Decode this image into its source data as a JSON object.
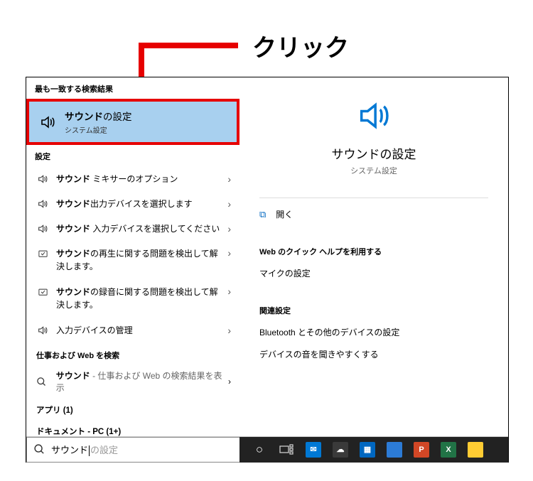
{
  "annotation": {
    "label": "クリック"
  },
  "left": {
    "best_match_header": "最も一致する検索結果",
    "best_match": {
      "title_bold": "サウンド",
      "title_rest": "の設定",
      "subtitle": "システム設定"
    },
    "settings_header": "設定",
    "rows": [
      {
        "icon": "speaker",
        "bold": "サウンド",
        "rest": " ミキサーのオプション",
        "chevron": true
      },
      {
        "icon": "speaker",
        "bold": "サウンド",
        "rest": "出力デバイスを選択します",
        "chevron": true
      },
      {
        "icon": "speaker",
        "bold": "サウンド",
        "rest": " 入力デバイスを選択してください",
        "chevron": true
      },
      {
        "icon": "trouble",
        "bold": "サウンド",
        "rest": "の再生に関する問題を検出して解決します。",
        "chevron": true,
        "twoline": true
      },
      {
        "icon": "trouble",
        "bold": "サウンド",
        "rest": "の録音に関する問題を検出して解決します。",
        "chevron": true,
        "twoline": true
      },
      {
        "icon": "speaker",
        "bold": "",
        "rest": "入力デバイスの管理",
        "chevron": true
      }
    ],
    "websearch_header": "仕事および Web を検索",
    "websearch": {
      "bold": "サウンド",
      "tail": " - 仕事および Web の検索結果を表示",
      "chevron": true
    },
    "apps_row": "アプリ (1)",
    "docs_row": "ドキュメント - PC (1+)"
  },
  "right": {
    "title": "サウンドの設定",
    "subtitle": "システム設定",
    "open_label": "開く",
    "quickhelp_header": "Web のクイック ヘルプを利用する",
    "quickhelp_link": "マイクの設定",
    "related_header": "関連設定",
    "related_links": [
      "Bluetooth とその他のデバイスの設定",
      "デバイスの音を聞きやすくする"
    ]
  },
  "search": {
    "typed": "サウンド",
    "placeholder_rest": "の設定"
  },
  "taskbar_apps": [
    {
      "name": "mail",
      "color": "#0078d4",
      "letter": "✉"
    },
    {
      "name": "weather",
      "color": "#3a3a3a",
      "letter": "☁"
    },
    {
      "name": "calendar",
      "color": "#0067c0",
      "letter": "▦"
    },
    {
      "name": "edge",
      "color": "#2c7bd6",
      "letter": ""
    },
    {
      "name": "powerpoint",
      "color": "#d24726",
      "letter": "P"
    },
    {
      "name": "excel",
      "color": "#217346",
      "letter": "X"
    },
    {
      "name": "explorer",
      "color": "#ffcc33",
      "letter": ""
    }
  ]
}
